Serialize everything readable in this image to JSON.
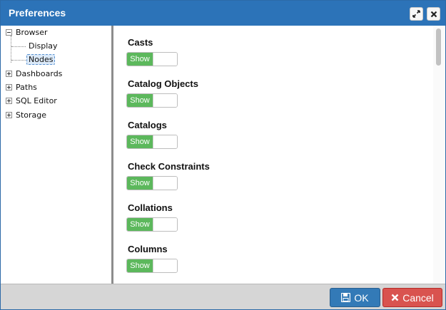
{
  "window": {
    "title": "Preferences"
  },
  "tree": {
    "items": [
      {
        "label": "Browser",
        "expanded": true
      },
      {
        "label": "Display"
      },
      {
        "label": "Nodes",
        "selected": true
      },
      {
        "label": "Dashboards",
        "expanded": false
      },
      {
        "label": "Paths",
        "expanded": false
      },
      {
        "label": "SQL Editor",
        "expanded": false
      },
      {
        "label": "Storage",
        "expanded": false
      }
    ]
  },
  "nodes": [
    {
      "title": "Casts",
      "toggle_label": "Show"
    },
    {
      "title": "Catalog Objects",
      "toggle_label": "Show"
    },
    {
      "title": "Catalogs",
      "toggle_label": "Show"
    },
    {
      "title": "Check Constraints",
      "toggle_label": "Show"
    },
    {
      "title": "Collations",
      "toggle_label": "Show"
    },
    {
      "title": "Columns",
      "toggle_label": "Show"
    }
  ],
  "footer": {
    "ok_label": "OK",
    "cancel_label": "Cancel"
  },
  "colors": {
    "titlebar": "#2c73b8",
    "toggle_on": "#5cb85c",
    "ok_button": "#337ab7",
    "cancel_button": "#d9534f"
  },
  "icons": {
    "maximize": "expand-arrows-icon",
    "close": "close-icon",
    "ok": "save-disk-icon",
    "cancel": "x-icon"
  }
}
